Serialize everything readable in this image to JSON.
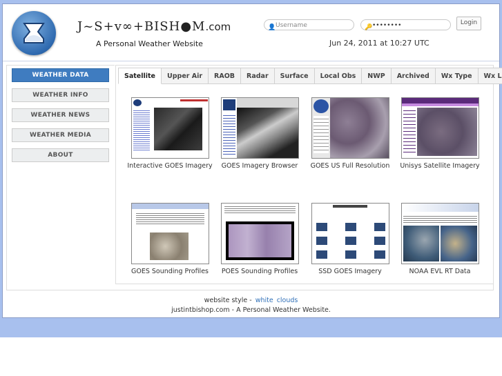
{
  "header": {
    "wordmark": "J~S+v∞+BISH●M",
    "domain_suffix": ".com",
    "tagline": "A Personal Weather Website",
    "login": {
      "username_placeholder": "Username",
      "password_value": "••••••••",
      "button_label": "Login"
    },
    "datetime": "Jun 24, 2011 at 10:27 UTC"
  },
  "sidebar": {
    "items": [
      "WEATHER DATA",
      "WEATHER INFO",
      "WEATHER NEWS",
      "WEATHER MEDIA",
      "ABOUT"
    ],
    "active": "WEATHER DATA"
  },
  "tabs": [
    "Satellite",
    "Upper Air",
    "RAOB",
    "Radar",
    "Surface",
    "Local Obs",
    "NWP",
    "Archived",
    "Wx Type",
    "Wx Links"
  ],
  "active_tab": "Satellite",
  "thumbnails": [
    {
      "label": "Interactive GOES Imagery"
    },
    {
      "label": "GOES Imagery Browser"
    },
    {
      "label": "GOES US Full Resolution"
    },
    {
      "label": "Unisys Satellite Imagery"
    },
    {
      "label": "GOES Sounding Profiles"
    },
    {
      "label": "POES Sounding Profiles"
    },
    {
      "label": "SSD GOES Imagery"
    },
    {
      "label": "NOAA EVL RT Data"
    }
  ],
  "footer": {
    "style_label": "website style -",
    "styles": [
      "white",
      "clouds"
    ],
    "copyright": "justintbishop.com - A Personal Weather Website."
  },
  "colors": {
    "accent": "#3f7cc0",
    "page_background": "#a8c0ee",
    "link": "#3070b8"
  }
}
